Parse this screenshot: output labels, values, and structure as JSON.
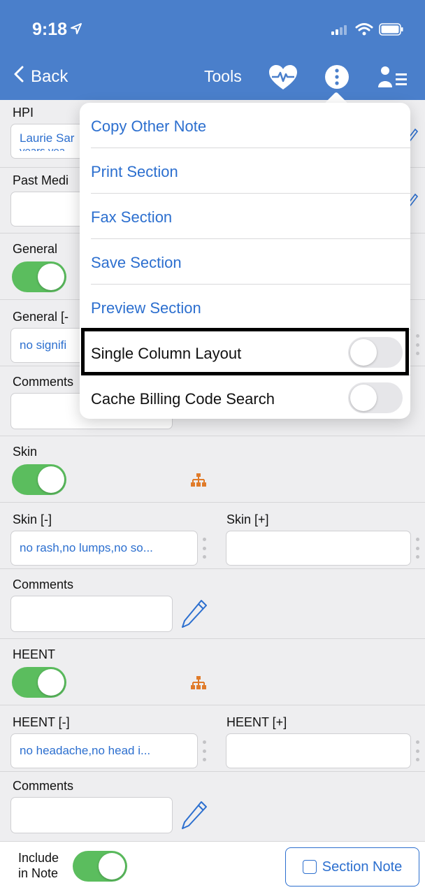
{
  "status": {
    "time": "9:18"
  },
  "nav": {
    "back_label": "Back",
    "tools_label": "Tools"
  },
  "rows": {
    "hpi": {
      "label": "HPI",
      "value": "Laurie Sar",
      "value_line2": "years yea"
    },
    "past_medical": {
      "label": "Past Medi"
    },
    "general": {
      "label": "General"
    },
    "general_neg": {
      "label": "General [-",
      "value": "no signifi"
    },
    "comments1": {
      "label": "Comments"
    },
    "skin": {
      "label": "Skin"
    },
    "skin_neg": {
      "label": "Skin [-]",
      "value": "no rash,no lumps,no so..."
    },
    "skin_pos": {
      "label": "Skin [+]",
      "value": ""
    },
    "comments2": {
      "label": "Comments"
    },
    "heent": {
      "label": "HEENT"
    },
    "heent_neg": {
      "label": "HEENT [-]",
      "value": "no headache,no head i..."
    },
    "heent_pos": {
      "label": "HEENT [+]",
      "value": ""
    },
    "comments3": {
      "label": "Comments"
    }
  },
  "menu": {
    "items": [
      {
        "label": "Copy Other Note"
      },
      {
        "label": "Print Section"
      },
      {
        "label": "Fax Section"
      },
      {
        "label": "Save Section"
      },
      {
        "label": "Preview Section"
      },
      {
        "label": "Single Column Layout",
        "toggle": "off"
      },
      {
        "label": "Cache Billing Code Search",
        "toggle": "off"
      }
    ]
  },
  "bottom": {
    "include_label_1": "Include",
    "include_label_2": "in Note",
    "section_note_label": "Section Note"
  },
  "colors": {
    "header": "#4a7fcb",
    "accent": "#2c6fcf",
    "toggle_on": "#5bbd5e",
    "tree_icon": "#e07b2a"
  }
}
